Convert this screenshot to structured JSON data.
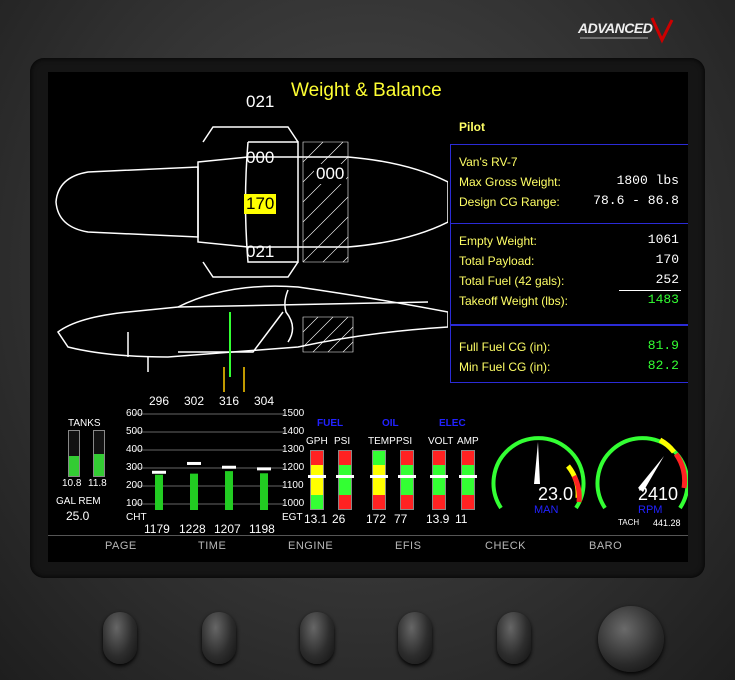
{
  "brand": {
    "name": "ADVANCED"
  },
  "screen": {
    "title": "Weight & Balance",
    "top_view": {
      "front_row_top": "021",
      "front_seat": "000",
      "rear_seat": "000",
      "pilot_weight": "170",
      "front_row_bottom": "021"
    },
    "panel": {
      "pilot_label": "Pilot",
      "aircraft": "Van's RV-7",
      "max_gross_label": "Max Gross Weight:",
      "max_gross_value": "1800  lbs",
      "design_cg_label": "Design CG Range:",
      "design_cg_value": "78.6 - 86.8",
      "empty_weight_label": "Empty Weight:",
      "empty_weight_value": "1061",
      "total_payload_label": "Total Payload:",
      "total_payload_value": "170",
      "total_fuel_label": "Total Fuel (42 gals):",
      "total_fuel_value": "252",
      "takeoff_weight_label": "Takeoff Weight (lbs):",
      "takeoff_weight_value": "1483",
      "full_fuel_cg_label": "Full Fuel CG (in):",
      "full_fuel_cg_value": "81.9",
      "min_fuel_cg_label": "Min Fuel CG (in):",
      "min_fuel_cg_value": "82.2"
    },
    "engine": {
      "tanks_label": "TANKS",
      "tank_left": "10.8",
      "tank_right": "11.8",
      "tank_left_level": 0.45,
      "tank_right_level": 0.5,
      "gal_rem_label": "GAL REM",
      "gal_rem_value": "25.0",
      "cht_top": [
        "296",
        "302",
        "316",
        "304"
      ],
      "egt_bottom": [
        "1179",
        "1228",
        "1207",
        "1198"
      ],
      "cht_scale": [
        "600",
        "500",
        "400",
        "300",
        "200",
        "100"
      ],
      "egt_scale": [
        "1500",
        "1400",
        "1300",
        "1200",
        "1100",
        "1000"
      ],
      "cht_label": "CHT",
      "egt_label": "EGT",
      "fuel_label": "FUEL",
      "oil_label": "OIL",
      "elec_label": "ELEC",
      "gauges": [
        {
          "label": "GPH",
          "value": "13.1"
        },
        {
          "label": "PSI",
          "value": "26"
        },
        {
          "label": "TEMP",
          "value": "172"
        },
        {
          "label": "PSI",
          "value": "77"
        },
        {
          "label": "VOLT",
          "value": "13.9"
        },
        {
          "label": "AMP",
          "value": "11"
        }
      ],
      "man_value": "23.0",
      "man_label": "MAN",
      "rpm_value": "2410",
      "rpm_label": "RPM",
      "tach_label": "TACH",
      "tach_value": "441.28"
    },
    "softkeys": [
      "PAGE",
      "TIME",
      "ENGINE",
      "EFIS",
      "CHECK",
      "BARO"
    ]
  },
  "colors": {
    "accent": "#ffff33",
    "panel_border": "#2b2bd6",
    "good": "#33ff33",
    "caution": "#ffff00",
    "warning": "#ff2222",
    "header_blue": "#2222ff"
  }
}
